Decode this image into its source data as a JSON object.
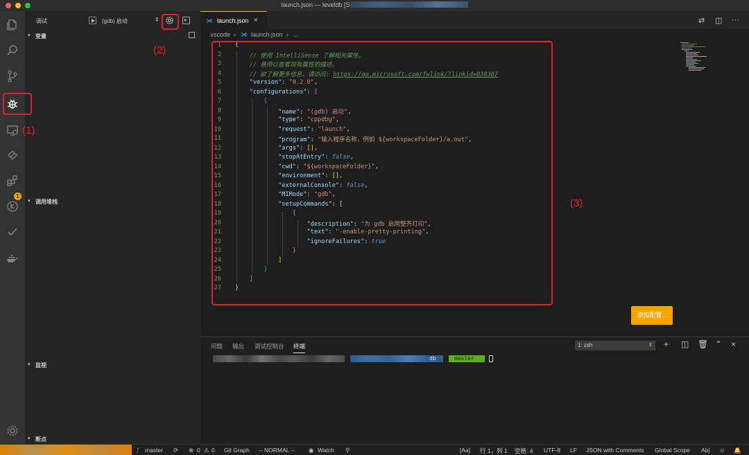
{
  "window": {
    "title": "launch.json — leveldb [S"
  },
  "activity_bar": {
    "badge_count": "1"
  },
  "debug": {
    "title": "调试",
    "config_name": "(gdb) 启动",
    "sections": {
      "variables": "变量",
      "call_stack": "调用堆栈",
      "watch": "监视",
      "breakpoints": "断点"
    }
  },
  "editor": {
    "tab_label": "launch.json",
    "breadcrumb": {
      "folder": ".vscode",
      "file": "launch.json",
      "more": "..."
    },
    "line_numbers": [
      "1",
      "2",
      "3",
      "4",
      "5",
      "6",
      "7",
      "8",
      "9",
      "10",
      "11",
      "12",
      "13",
      "14",
      "15",
      "16",
      "17",
      "18",
      "19",
      "20",
      "21",
      "22",
      "23",
      "24",
      "25",
      "26",
      "27"
    ],
    "code": {
      "comment1": "// 使用 IntelliSense 了解相关属性。",
      "comment2": "// 悬停以查看现有属性的描述。",
      "comment3_prefix": "// 欲了解更多信息，请访问: ",
      "comment3_url": "https://go.microsoft.com/fwlink/?linkid=830387",
      "version_key": "\"version\"",
      "version_val": "\"0.2.0\"",
      "configurations_key": "\"configurations\"",
      "name_key": "\"name\"",
      "name_val": "\"(gdb) 启动\"",
      "type_key": "\"type\"",
      "type_val": "\"cppdbg\"",
      "request_key": "\"request\"",
      "request_val": "\"launch\"",
      "program_key": "\"program\"",
      "program_val": "\"输入程序名称，例如 ${workspaceFolder}/a.out\"",
      "args_key": "\"args\"",
      "args_val": "[]",
      "stopAtEntry_key": "\"stopAtEntry\"",
      "stopAtEntry_val": "false",
      "cwd_key": "\"cwd\"",
      "cwd_val": "\"${workspaceFolder}\"",
      "environment_key": "\"environment\"",
      "environment_val": "[]",
      "externalConsole_key": "\"externalConsole\"",
      "externalConsole_val": "false",
      "MIMode_key": "\"MIMode\"",
      "MIMode_val": "\"gdb\"",
      "setupCommands_key": "\"setupCommands\"",
      "description_key": "\"description\"",
      "description_val": "\"为 gdb 启用整齐打印\"",
      "text_key": "\"text\"",
      "text_val": "\"-enable-pretty-printing\"",
      "ignoreFailures_key": "\"ignoreFailures\"",
      "ignoreFailures_val": "true"
    },
    "add_config_button": "添加配置..."
  },
  "annotations": {
    "label1": "(1)",
    "label2": "(2)",
    "label3": "(3)"
  },
  "panel": {
    "tabs": [
      "问题",
      "输出",
      "调试控制台",
      "终端"
    ],
    "terminal_select": "1: zsh",
    "prompt": {
      "dir": "db",
      "branch": "master"
    }
  },
  "status_bar": {
    "branch": "master",
    "errors": "0",
    "warnings": "0",
    "git_graph": "Git Graph",
    "mode": "-- NORMAL --",
    "watch": "Watch",
    "aa": "[Aa]",
    "position": "行 1，列 1",
    "spaces": "空格: 4",
    "encoding": "UTF-8",
    "eol": "LF",
    "language": "JSON with Comments",
    "scope": "Global Scope",
    "ab": "Ab|"
  },
  "colors": {
    "accent_orange": "#f8a300",
    "annotation_red": "#e3212c",
    "terminal_green": "#5fae1c"
  }
}
